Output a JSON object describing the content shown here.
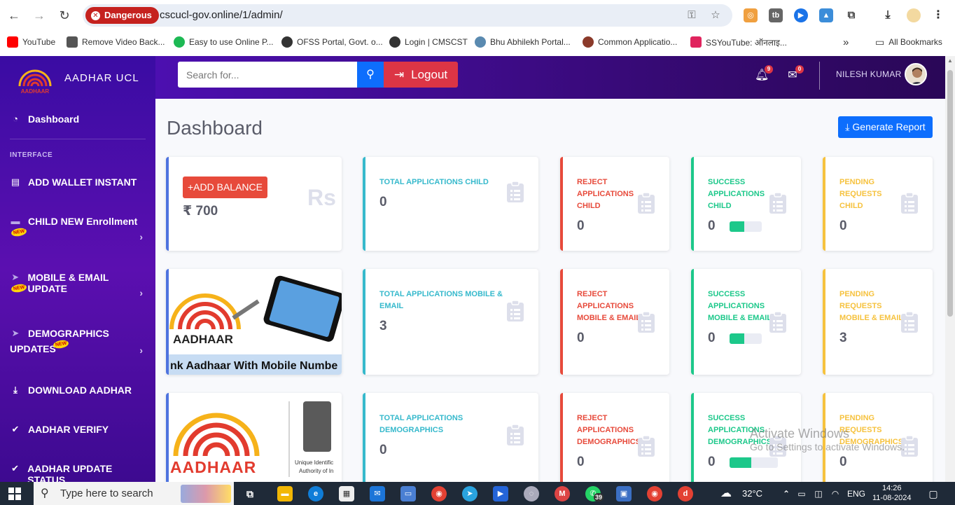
{
  "browser": {
    "security_label": "Dangerous",
    "url": "cscucl-gov.online/1/admin/",
    "bookmarks": [
      "YouTube",
      "Remove Video Back...",
      "Easy to use Online P...",
      "OFSS Portal, Govt. o...",
      "Login | CMSCST",
      "Bhu Abhilekh Portal...",
      "Common Applicatio...",
      "SSYouTube: ऑनलाइ..."
    ],
    "more_bookmarks": "»",
    "all_bookmarks": "All Bookmarks"
  },
  "sidebar": {
    "brand": "AADHAR UCL",
    "logo_text": "AADHAAR",
    "dashboard": "Dashboard",
    "section_heading": "INTERFACE",
    "new_badge": "NEW",
    "items": {
      "wallet": "ADD WALLET INSTANT",
      "child": "CHILD NEW Enrollment",
      "mobile": "MOBILE & EMAIL UPDATE",
      "demo_line1": "DEMOGRAPHICS",
      "demo_line2": "UPDATES",
      "download": "DOWNLOAD AADHAR",
      "verify": "AADHAR VERIFY",
      "status": "AADHAR UPDATE STATUS"
    }
  },
  "topbar": {
    "search_placeholder": "Search for...",
    "logout": "Logout",
    "alerts_count": "9",
    "messages_count": "0",
    "username": "NILESH KUMAR"
  },
  "main": {
    "title": "Dashboard",
    "generate_report": "Generate Report",
    "add_balance": "+ADD BALANCE",
    "balance": "₹ 700",
    "balance_icon": "Rs",
    "banner1_text": "AADHAAR",
    "banner1_caption": "nk Aadhaar With Mobile Numbe",
    "banner2_text": "AADHAAR",
    "banner2_caption1": "Unique Identific",
    "banner2_caption2": "Authority of In",
    "rows": [
      [
        {
          "label": "TOTAL APPLICATIONS CHILD",
          "value": "0"
        },
        {
          "label": "REJECT APPLICATIONS CHILD",
          "value": "0"
        },
        {
          "label": "SUCCESS APPLICATIONS CHILD",
          "value": "0",
          "progress": 0.45
        },
        {
          "label": "PENDING REQUESTS CHILD",
          "value": "0"
        }
      ],
      [
        {
          "label": "TOTAL APPLICATIONS MOBILE & EMAIL",
          "value": "3"
        },
        {
          "label": "REJECT APPLICATIONS MOBILE & EMAIL",
          "value": "0"
        },
        {
          "label": "SUCCESS APPLICATIONS MOBILE & EMAIL",
          "value": "0",
          "progress": 0.45
        },
        {
          "label": "PENDING REQUESTS MOBILE & EMAIL",
          "value": "3"
        }
      ],
      [
        {
          "label": "TOTAL APPLICATIONS DEMOGRAPHICS",
          "value": "0"
        },
        {
          "label": "REJECT APPLICATIONS DEMOGRAPHICS",
          "value": "0"
        },
        {
          "label": "SUCCESS APPLICATIONS DEMOGRAPHICS",
          "value": "0",
          "progress": 0.45
        },
        {
          "label": "PENDING REQUESTS DEMOGRAPHICS",
          "value": "0"
        }
      ]
    ]
  },
  "watermark": {
    "title": "Activate Windows",
    "subtitle": "Go to Settings to activate Windows."
  },
  "taskbar": {
    "search_text": "Type here to search",
    "badge_count": "39",
    "temperature": "32°C",
    "language": "ENG",
    "time": "14:26",
    "date": "11-08-2024"
  },
  "colors": {
    "accent": "#0d6efd",
    "danger": "#e74a3b",
    "success": "#1cc88a",
    "warning": "#f6c23e",
    "info": "#36b9cc",
    "sidebar": "#5b0fb0"
  }
}
